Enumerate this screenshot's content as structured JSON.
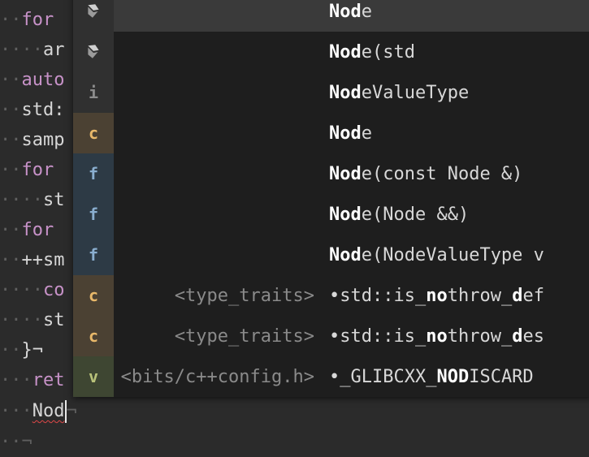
{
  "editor": {
    "lines": [
      {
        "indent": "··",
        "text": "for",
        "style": "kw"
      },
      {
        "indent": "····",
        "text": "ar",
        "style": "plain"
      },
      {
        "indent": "··",
        "text": "auto",
        "style": "kw"
      },
      {
        "indent": "··",
        "text": "std:",
        "style": "plain"
      },
      {
        "indent": "··",
        "text": "samp",
        "style": "plain"
      },
      {
        "indent": "··",
        "text": "for",
        "style": "kw"
      },
      {
        "indent": "····",
        "text": "st",
        "style": "plain"
      },
      {
        "indent": "··",
        "text": "for",
        "style": "kw"
      },
      {
        "indent": "··",
        "text": "++sm",
        "style": "plain"
      },
      {
        "indent": "····",
        "text": "co",
        "style": "kw"
      },
      {
        "indent": "····",
        "text": "st",
        "style": "plain"
      },
      {
        "indent": "··",
        "text": "}¬",
        "style": "plain"
      },
      {
        "indent": "···",
        "text": "ret",
        "style": "kw"
      },
      {
        "indent": "···",
        "text": "Nod",
        "style": "squiggle",
        "caret": true,
        "eol": "¬"
      },
      {
        "indent": "··",
        "text": "¬",
        "style": "ws"
      }
    ]
  },
  "completion": {
    "items": [
      {
        "kind": "keyword",
        "kind_icon": "keyword-icon",
        "origin": "",
        "match": "Nod",
        "rest": "e",
        "selected": true
      },
      {
        "kind": "keyword",
        "kind_icon": "keyword-icon",
        "origin": "",
        "match": "Nod",
        "rest": "e(std"
      },
      {
        "kind": "info",
        "kind_letter": "i",
        "origin": "",
        "match": "Nod",
        "rest": "eValueType"
      },
      {
        "kind": "class",
        "kind_letter": "c",
        "origin": "",
        "match": "Nod",
        "rest": "e"
      },
      {
        "kind": "function",
        "kind_letter": "f",
        "origin": "",
        "match": "Nod",
        "rest": "e(const Node &)"
      },
      {
        "kind": "function",
        "kind_letter": "f",
        "origin": "",
        "match": "Nod",
        "rest": "e(Node &&)"
      },
      {
        "kind": "function",
        "kind_letter": "f",
        "origin": "",
        "match": "Nod",
        "rest": "e(NodeValueType v"
      },
      {
        "kind": "class",
        "kind_letter": "c",
        "origin": "<type_traits>",
        "label_html": "•std::is_<b>no</b>throw_<b>d</b>ef"
      },
      {
        "kind": "class",
        "kind_letter": "c",
        "origin": "<type_traits>",
        "label_html": "•std::is_<b>no</b>throw_<b>d</b>es"
      },
      {
        "kind": "variable",
        "kind_letter": "v",
        "origin": "<bits/c++config.h>",
        "label_html": "•_GLIBCXX_<b>NOD</b>ISCARD"
      }
    ]
  },
  "colors": {
    "background": "#2b2b2b",
    "popup_background": "#1e1e1e",
    "selected_row": "#3a3a3a",
    "class_badge": "#e8b86a",
    "function_badge": "#8aaecf",
    "variable_badge": "#b9c27a",
    "keyword_text": "#c792c8",
    "error_squiggle": "#e04848"
  }
}
